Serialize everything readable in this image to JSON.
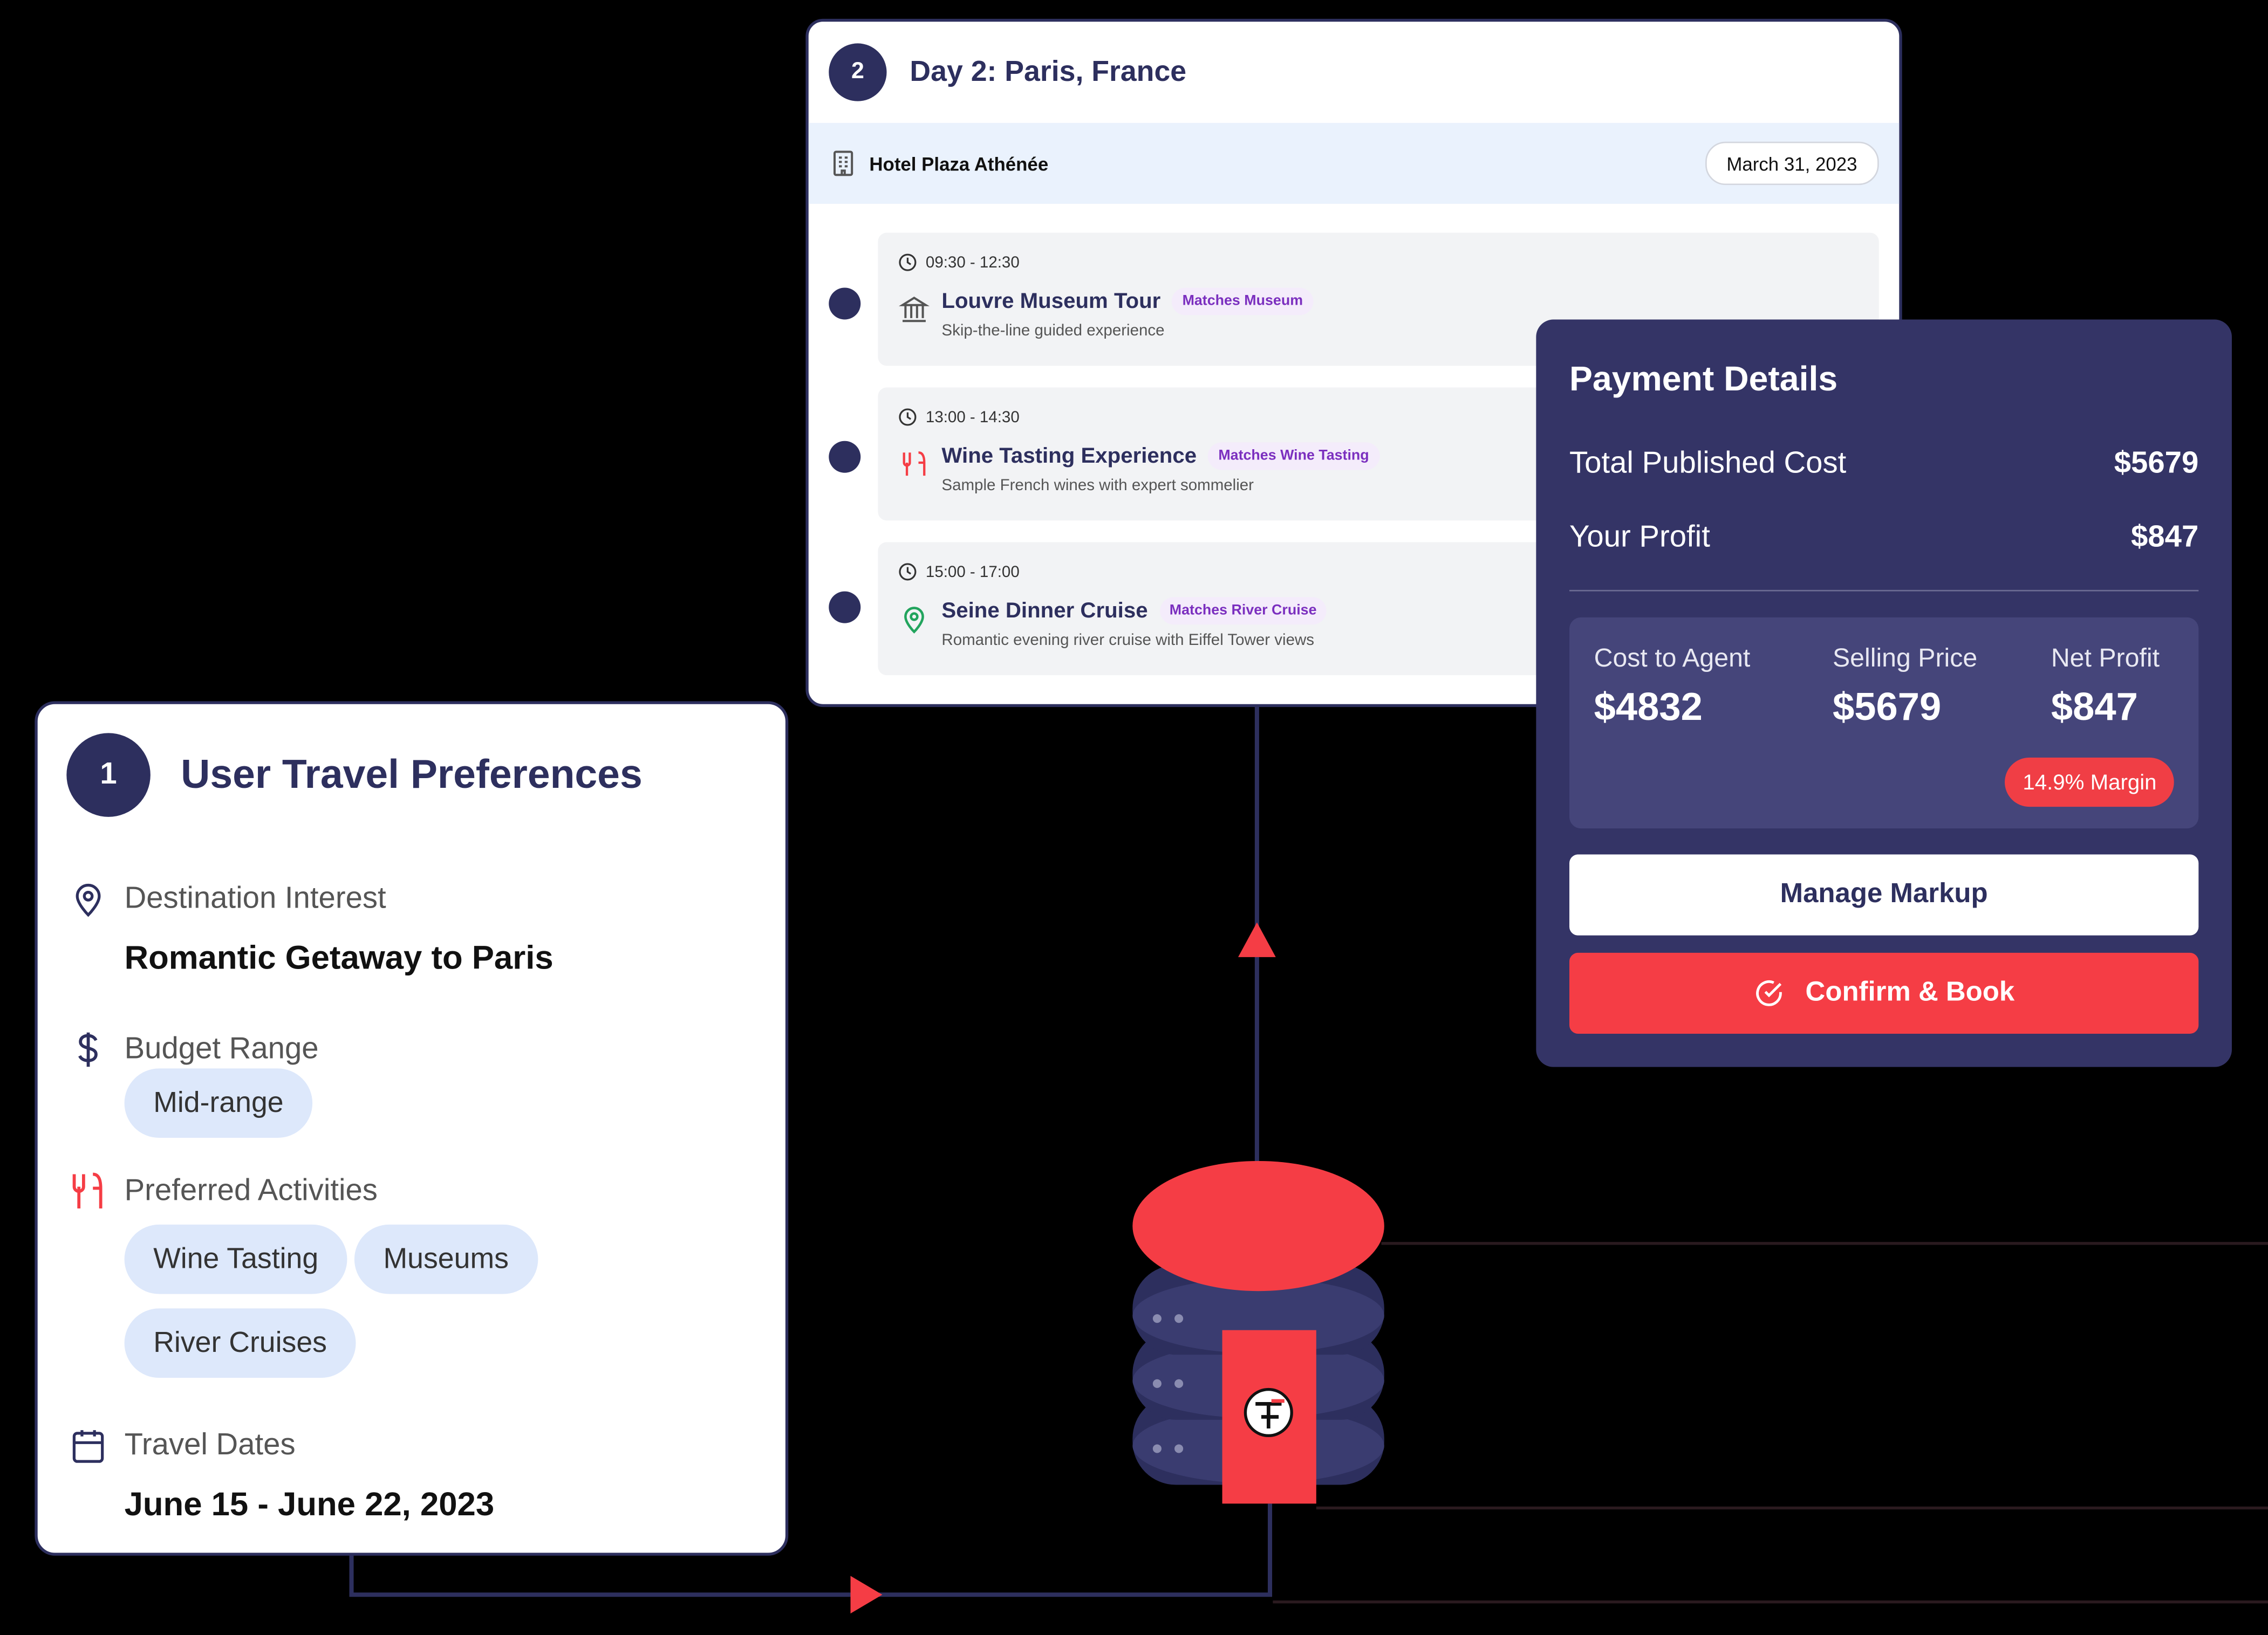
{
  "day_card": {
    "number": "2",
    "title": "Day 2: Paris, France",
    "hotel": "Hotel Plaza Athénée",
    "date": "March 31, 2023",
    "activities": [
      {
        "time": "09:30 - 12:30",
        "title": "Louvre Museum Tour",
        "badge": "Matches Museum",
        "desc": "Skip-the-line guided experience",
        "icon": "museum-icon"
      },
      {
        "time": "13:00 - 14:30",
        "title": "Wine Tasting Experience",
        "badge": "Matches Wine Tasting",
        "desc": "Sample French wines with expert sommelier",
        "icon": "utensils-icon"
      },
      {
        "time": "15:00 - 17:00",
        "title": "Seine Dinner Cruise",
        "badge": "Matches River Cruise",
        "desc": "Romantic evening river cruise with Eiffel Tower views",
        "icon": "map-pin-icon"
      }
    ]
  },
  "payment": {
    "title": "Payment Details",
    "total_label": "Total Published Cost",
    "total_value": "$5679",
    "profit_label": "Your Profit",
    "profit_value": "$847",
    "cost_agent_label": "Cost to Agent",
    "cost_agent_value": "$4832",
    "selling_label": "Selling Price",
    "selling_value": "$5679",
    "net_label": "Net Profit",
    "net_value": "$847",
    "margin": "14.9% Margin",
    "manage_label": "Manage Markup",
    "confirm_label": "Confirm & Book"
  },
  "preferences": {
    "number": "1",
    "title": "User Travel Preferences",
    "destination_label": "Destination Interest",
    "destination_value": "Romantic Getaway to Paris",
    "budget_label": "Budget Range",
    "budget_chip": "Mid-range",
    "activities_label": "Preferred Activities",
    "activity_chips": [
      "Wine Tasting",
      "Museums",
      "River Cruises"
    ],
    "dates_label": "Travel Dates",
    "dates_value": "June 15 - June 22, 2023"
  },
  "colors": {
    "navy": "#2d2f5e",
    "accent_red": "#f53d45",
    "payment_bg": "#343466",
    "chip_bg": "#dde8fb",
    "badge_purple": "#7b2fbf"
  }
}
